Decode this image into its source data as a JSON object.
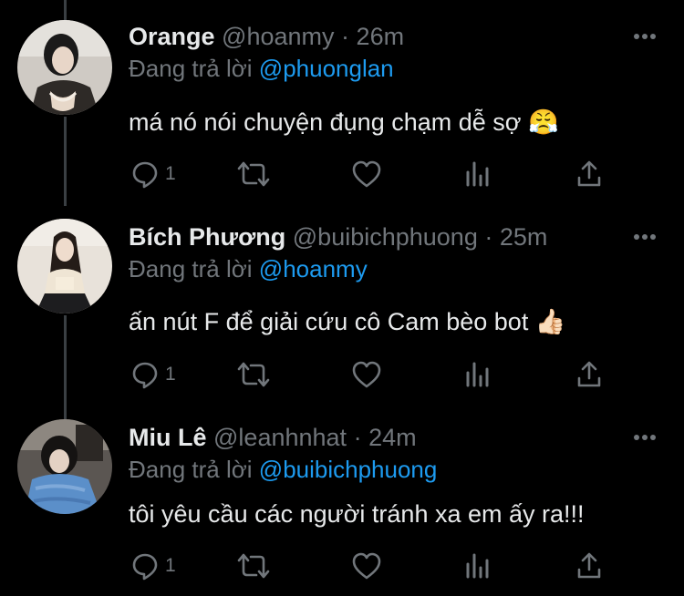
{
  "theme": {
    "background": "#000000",
    "text": "#e7e9ea",
    "muted": "#71767b",
    "link": "#1d9bf0",
    "thread_line": "#3a3f43"
  },
  "replying_label": "Đang trả lời",
  "tweets": [
    {
      "name": "Orange",
      "handle": "@hoanmy",
      "time": "26m",
      "replying_to": "@phuonglan",
      "text": "má nó nói chuyện đụng chạm dễ sợ",
      "emoji": "😤",
      "reply_count": "1",
      "avatar_icon": "user-avatar-orange"
    },
    {
      "name": "Bích Phương",
      "handle": "@buibichphuong",
      "time": "25m",
      "replying_to": "@hoanmy",
      "text": "ấn nút F để giải cứu cô Cam bèo bot",
      "emoji": "👍🏻",
      "reply_count": "1",
      "avatar_icon": "user-avatar-bich-phuong"
    },
    {
      "name": "Miu Lê",
      "handle": "@leanhnhat",
      "time": "24m",
      "replying_to": "@buibichphuong",
      "text": "tôi yêu cầu các người tránh xa em ấy ra!!!",
      "emoji": "",
      "reply_count": "1",
      "avatar_icon": "user-avatar-miu-le"
    }
  ],
  "separator": "·",
  "action_icons": [
    "reply-icon",
    "retweet-icon",
    "like-icon",
    "analytics-icon",
    "share-icon"
  ]
}
